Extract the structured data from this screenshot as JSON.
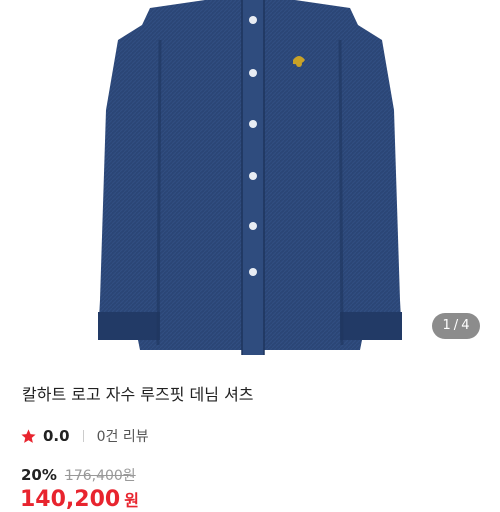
{
  "product": {
    "title": "칼하트 로고 자수 루즈핏 데님 셔츠",
    "image_counter": {
      "current": "1",
      "separator": "/",
      "total": "4"
    },
    "rating": {
      "value": "0.0",
      "review_count": "0건 리뷰"
    },
    "price": {
      "discount": "20%",
      "original": "176,400원",
      "sale": "140,200",
      "sale_unit": "원"
    }
  },
  "colors": {
    "denim": "#2a4574",
    "star": "#e8242e",
    "sale_price": "#e8242e",
    "logo_embroidery": "#c9a227"
  },
  "icons": {
    "rating": "star-icon"
  }
}
